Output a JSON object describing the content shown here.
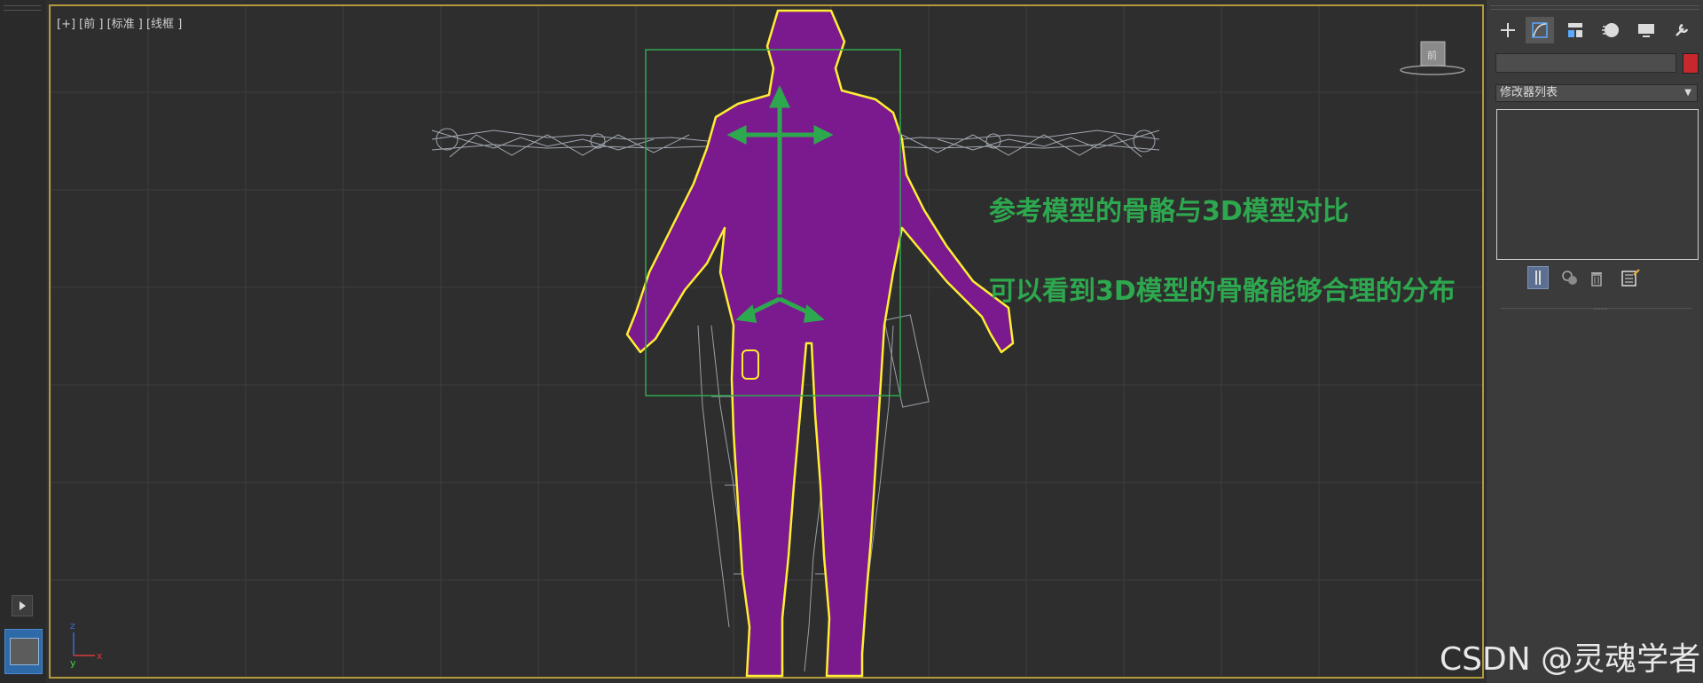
{
  "viewport": {
    "label": "[+] [前 ] [标准 ] [线框 ]",
    "axis_z": "z",
    "axis_y": "y",
    "axis_x": "x",
    "colors": {
      "grid": "#3e3e3e",
      "wire": "#b6bcc8",
      "body": "#7a1a8e",
      "outline": "#ffee33",
      "bbox": "#2ea84f"
    }
  },
  "annotations": {
    "line1": "参考模型的骨骼与3D模型对比",
    "line2": "可以看到3D模型的骨骼能够合理的分布"
  },
  "command_panel": {
    "tabs": [
      {
        "icon": "plus-icon",
        "label": "create"
      },
      {
        "icon": "modify-curve-icon",
        "label": "modify"
      },
      {
        "icon": "hierarchy-icon",
        "label": "hierarchy"
      },
      {
        "icon": "motion-icon",
        "label": "motion"
      },
      {
        "icon": "display-icon",
        "label": "display"
      },
      {
        "icon": "wrench-icon",
        "label": "utilities"
      }
    ],
    "name_value": "",
    "object_color": "#c8272d",
    "modifier_list_label": "修改器列表"
  },
  "watermark": "CSDN @灵魂学者"
}
